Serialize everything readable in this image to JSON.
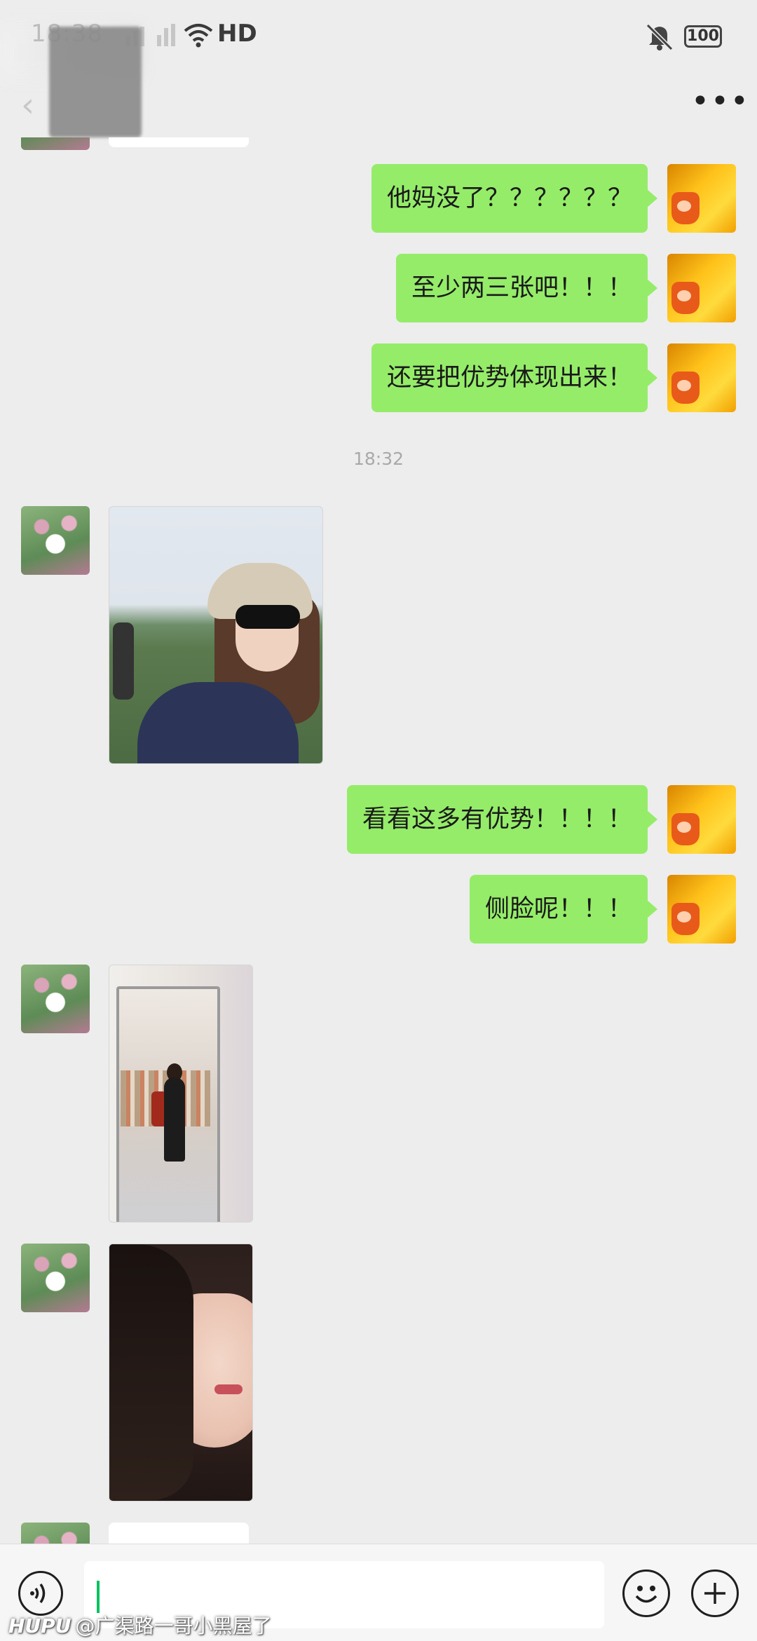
{
  "status_bar": {
    "time": "18:38",
    "network": "HD",
    "battery": "100",
    "signal": "4G 2G"
  },
  "nav": {
    "title": "",
    "more_icon": "more-dots-icon"
  },
  "messages": [
    {
      "side": "right",
      "type": "text",
      "text": "他妈没了？？？？？？"
    },
    {
      "side": "right",
      "type": "text",
      "text": "至少两三张吧！！！"
    },
    {
      "side": "right",
      "type": "text",
      "text": "还要把优势体现出来！"
    },
    {
      "type": "timestamp",
      "text": "18:32"
    },
    {
      "side": "left",
      "type": "image",
      "description": "photo"
    },
    {
      "side": "right",
      "type": "text",
      "text": "看看这多有优势！！！！"
    },
    {
      "side": "right",
      "type": "text",
      "text": "侧脸呢！！！"
    },
    {
      "side": "left",
      "type": "image",
      "description": "photo"
    },
    {
      "side": "left",
      "type": "image",
      "description": "photo"
    }
  ],
  "input": {
    "value": "",
    "voice_icon": "voice-icon",
    "emoji_icon": "emoji-icon",
    "plus_icon": "plus-icon"
  },
  "watermark": {
    "brand": "HUPU",
    "text": "@广渠路一哥小黑屋了"
  }
}
